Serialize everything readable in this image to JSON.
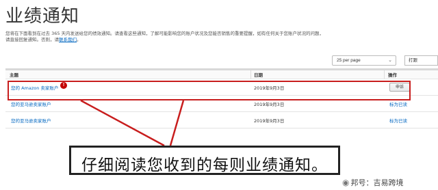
{
  "page": {
    "title": "业绩通知",
    "intro_text": "您将在下面看到在过去 365 天内发送给您的绩效通知。请查看这些通知，了解可能影响您的账户状况及您能否销售的重要提醒，如有任何关于您账户状况的问题，请直接回复通知。否则，请",
    "intro_link": "联系我们",
    "intro_end": "。"
  },
  "controls": {
    "per_page": "25 per page",
    "sort_label": "打跟"
  },
  "table": {
    "headers": {
      "subject": "主题",
      "date": "日期",
      "action": "操作"
    },
    "rows": [
      {
        "subject": "您的 Amazon 卖家账户",
        "date": "2019年9月3日",
        "action": "申诉",
        "action_type": "button",
        "has_alert": true
      },
      {
        "subject": "您的亚马逊卖家账户",
        "date": "2019年9月3日",
        "action": "标为已读",
        "action_type": "link",
        "has_alert": false
      },
      {
        "subject": "您的亚马逊卖家账户",
        "date": "2019年9月3日",
        "action": "标为已读",
        "action_type": "link",
        "has_alert": false
      }
    ]
  },
  "annotation": {
    "caption": "仔细阅读您收到的每则业绩通知。",
    "highlight_color": "#c81d1d"
  },
  "watermark": {
    "icon": "wechat-icon",
    "text": "邦号：吉易跨境"
  }
}
